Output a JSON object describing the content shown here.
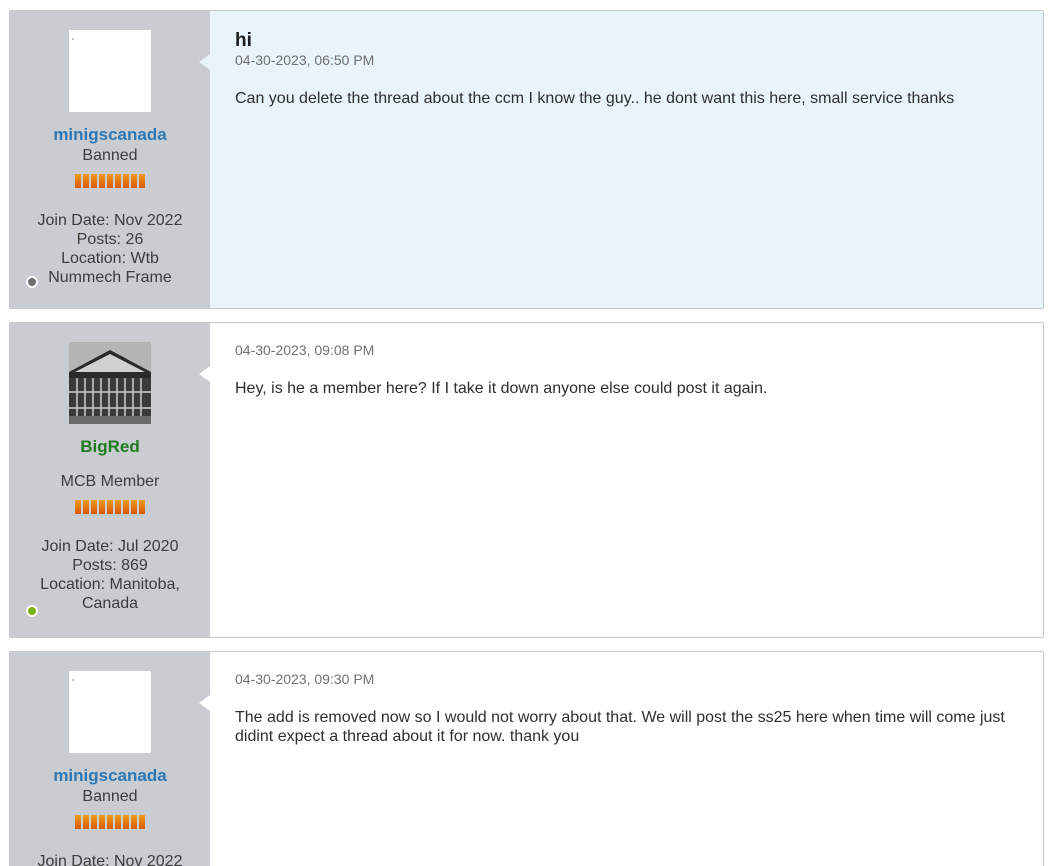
{
  "posts": [
    {
      "user": {
        "name": "minigscanada",
        "title": "Banned",
        "join_date": "Join Date: Nov 2022",
        "posts": "Posts: 26",
        "location": "Location: Wtb Nummech Frame",
        "status": "offline",
        "avatar": "blank"
      },
      "title": "hi",
      "date": "04-30-2023, 06:50 PM",
      "content": "Can you delete the thread about the ccm I know the guy.. he dont want this here, small service thanks"
    },
    {
      "user": {
        "name": "BigRed",
        "title": "MCB Member",
        "join_date": "Join Date: Jul 2020",
        "posts": "Posts: 869",
        "location": "Location: Manitoba, Canada",
        "status": "online",
        "avatar": "building-gate-photo"
      },
      "title": "",
      "date": "04-30-2023, 09:08 PM",
      "content": "Hey, is he a member here? If I take it down anyone else could post it again."
    },
    {
      "user": {
        "name": "minigscanada",
        "title": "Banned",
        "join_date": "Join Date: Nov 2022",
        "status": "offline",
        "avatar": "blank"
      },
      "title": "",
      "date": "04-30-2023, 09:30 PM",
      "content": "The add is removed now so I would not worry about that. We will post the ss25 here when time will come just didint expect a thread about it for now. thank you"
    }
  ],
  "colors": {
    "userinfo_bg": "#c9ccd0",
    "highlight_bg": "#e9f3fa",
    "banned_name": "#2c78b6",
    "member_name": "#1e7d1e",
    "reputation": "#e67812",
    "online": "#7bb51a",
    "offline": "#6e6e6e"
  }
}
